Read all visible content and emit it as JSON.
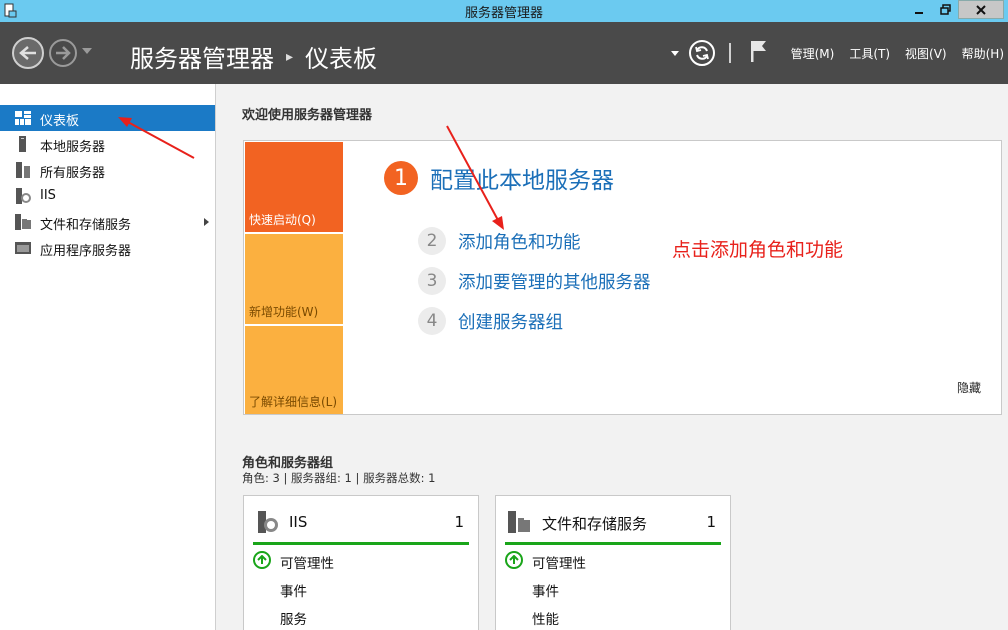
{
  "window": {
    "title": "服务器管理器"
  },
  "header": {
    "breadcrumb": [
      "服务器管理器",
      "仪表板"
    ],
    "menu": [
      "管理(M)",
      "工具(T)",
      "视图(V)",
      "帮助(H)"
    ]
  },
  "sidebar": {
    "items": [
      {
        "label": "仪表板",
        "icon": "dashboard-icon",
        "active": true
      },
      {
        "label": "本地服务器",
        "icon": "server-icon"
      },
      {
        "label": "所有服务器",
        "icon": "servers-icon"
      },
      {
        "label": "IIS",
        "icon": "iis-icon"
      },
      {
        "label": "文件和存储服务",
        "icon": "storage-icon",
        "has_submenu": true
      },
      {
        "label": "应用程序服务器",
        "icon": "app-server-icon"
      }
    ]
  },
  "welcome": {
    "title": "欢迎使用服务器管理器",
    "tiles": [
      "快速启动(Q)",
      "新增功能(W)",
      "了解详细信息(L)"
    ],
    "steps": [
      {
        "num": "1",
        "label": "配置此本地服务器"
      },
      {
        "num": "2",
        "label": "添加角色和功能"
      },
      {
        "num": "3",
        "label": "添加要管理的其他服务器"
      },
      {
        "num": "4",
        "label": "创建服务器组"
      }
    ],
    "hide_label": "隐藏"
  },
  "annotation": {
    "text": "点击添加角色和功能",
    "color": "#e8211b"
  },
  "roles": {
    "title": "角色和服务器组",
    "summary": "角色: 3 | 服务器组: 1 | 服务器总数: 1",
    "cards": [
      {
        "title": "IIS",
        "count": "1",
        "rows": [
          "可管理性",
          "事件",
          "服务"
        ]
      },
      {
        "title": "文件和存储服务",
        "count": "1",
        "rows": [
          "可管理性",
          "事件",
          "性能"
        ]
      }
    ]
  },
  "colors": {
    "accent": "#1b7ac6",
    "tile_primary": "#f26322",
    "tile_secondary": "#fbb040",
    "status_ok": "#1aa51a"
  }
}
